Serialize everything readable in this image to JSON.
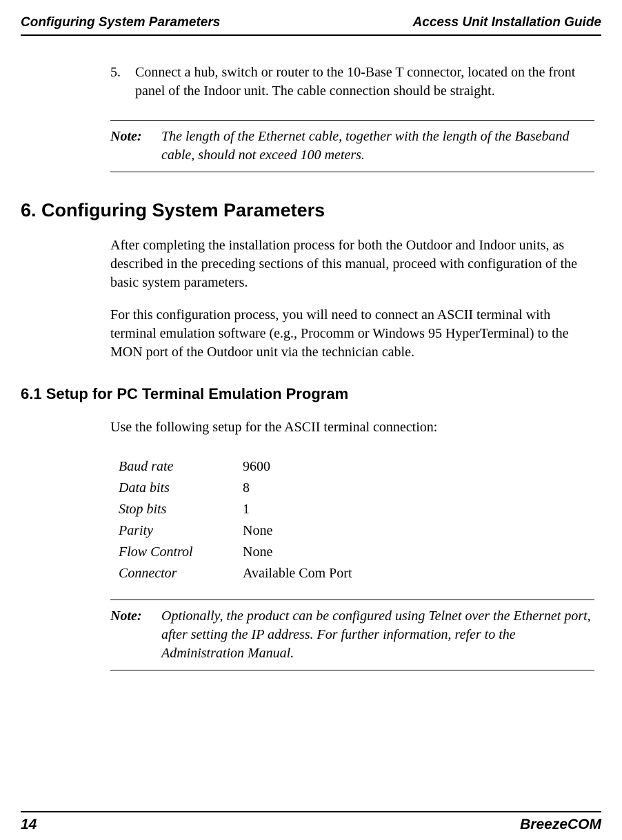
{
  "header": {
    "left": "Configuring System Parameters",
    "right": "Access Unit Installation Guide"
  },
  "step5": {
    "num": "5.",
    "text": "Connect a hub, switch or router to the 10-Base T connector, located on the front panel of the Indoor unit. The cable connection should be straight."
  },
  "note1": {
    "label": "Note:",
    "text": "The length of the Ethernet cable, together with the length of the Baseband cable, should not exceed 100 meters."
  },
  "section6": {
    "title": "6.  Configuring System Parameters",
    "p1": "After completing the installation process for both the Outdoor and Indoor units, as described in the preceding sections of this manual, proceed with configuration of the basic system parameters.",
    "p2": "For this configuration process, you will need to connect an ASCII terminal with terminal emulation software (e.g., Procomm or Windows 95 HyperTerminal) to the MON port of the Outdoor unit via the technician cable."
  },
  "section61": {
    "title": "6.1  Setup for PC Terminal Emulation Program",
    "p1": "Use the following setup for the ASCII terminal connection:",
    "settings": [
      {
        "label": "Baud rate",
        "value": "9600"
      },
      {
        "label": "Data bits",
        "value": "8"
      },
      {
        "label": "Stop bits",
        "value": "1"
      },
      {
        "label": "Parity",
        "value": "None"
      },
      {
        "label": "Flow Control",
        "value": "None"
      },
      {
        "label": "Connector",
        "value": "Available Com Port"
      }
    ]
  },
  "note2": {
    "label": "Note:",
    "text": "Optionally, the product can be configured using Telnet over the Ethernet port, after setting the IP address. For further information, refer to the Administration Manual."
  },
  "footer": {
    "page": "14",
    "brand": "BreezeCOM"
  }
}
